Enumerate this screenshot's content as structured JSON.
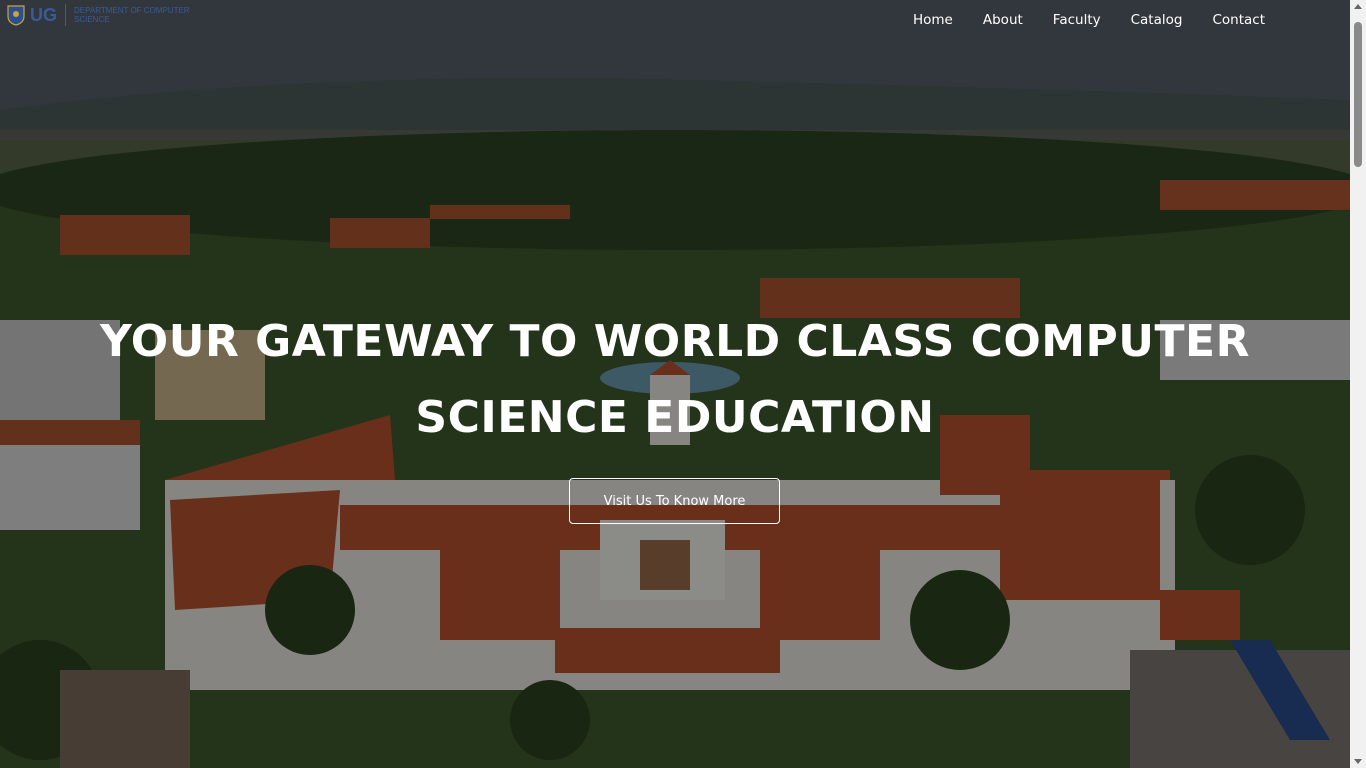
{
  "logo": {
    "short": "UG",
    "department": "DEPARTMENT OF COMPUTER SCIENCE"
  },
  "nav": {
    "items": [
      {
        "label": "Home"
      },
      {
        "label": "About"
      },
      {
        "label": "Faculty"
      },
      {
        "label": "Catalog"
      },
      {
        "label": "Contact"
      }
    ]
  },
  "hero": {
    "headline_line1": "YOUR GATEWAY TO WORLD CLASS COMPUTER",
    "headline_line2": "SCIENCE EDUCATION",
    "cta_label": "Visit Us To Know More"
  },
  "colors": {
    "roof": "#b5522f",
    "foliage": "#2f4a22",
    "overlay": "rgba(0,0,0,0.42)",
    "logo_blue": "#3a5a9a"
  }
}
